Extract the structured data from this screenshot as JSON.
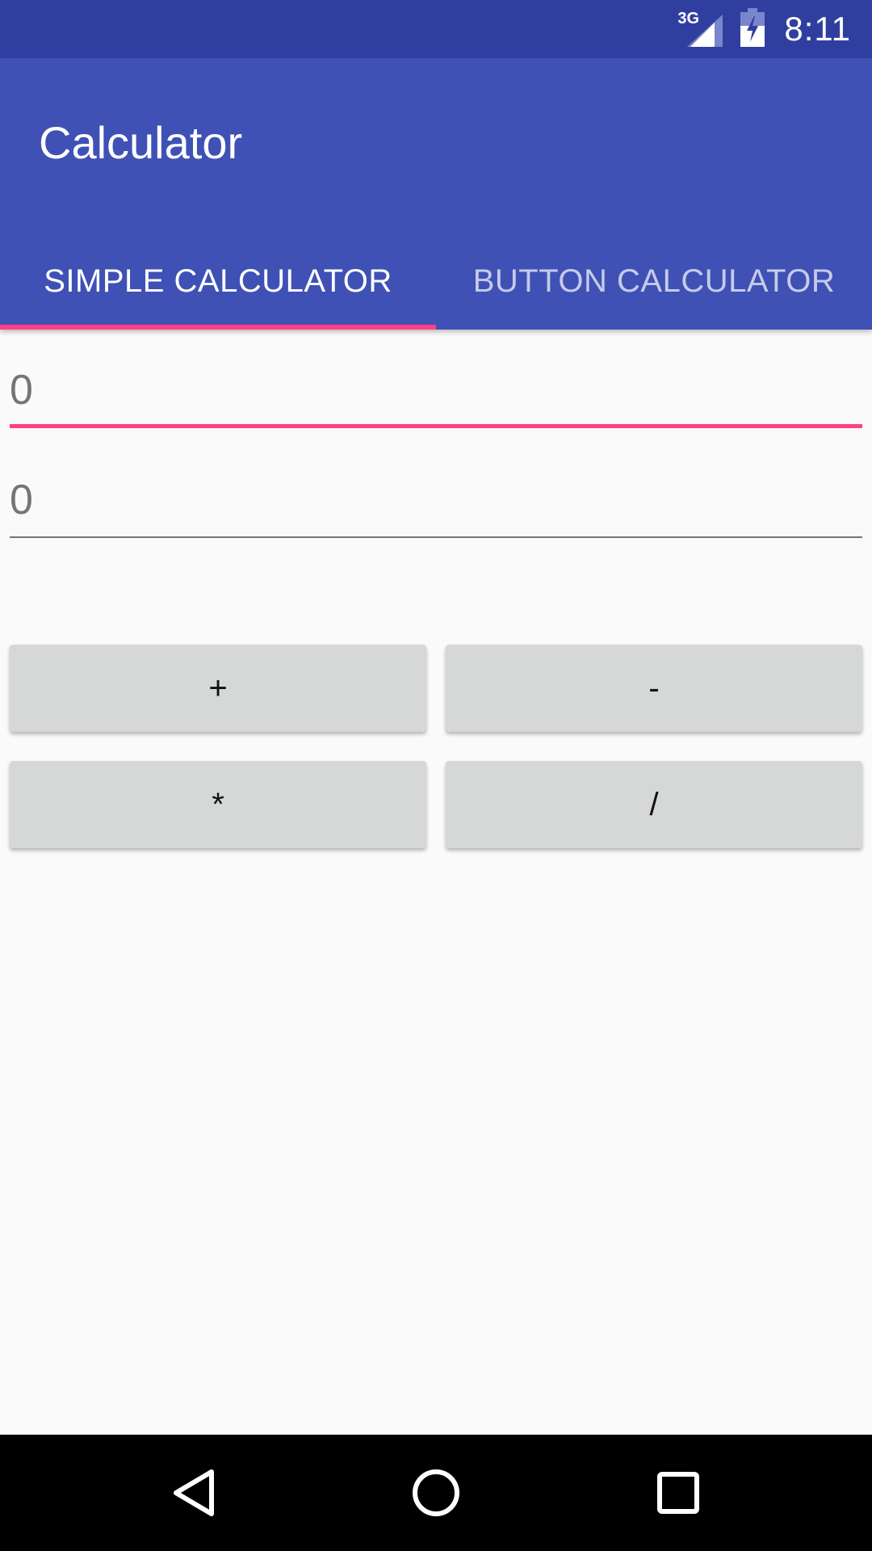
{
  "status_bar": {
    "network": "3G",
    "time": "8:11",
    "icons": [
      "signal-icon",
      "battery-charging-icon"
    ]
  },
  "app_bar": {
    "title": "Calculator",
    "colors": {
      "primary": "#3f51b5",
      "primary_dark": "#303f9f",
      "accent": "#ff4081"
    }
  },
  "tabs": [
    {
      "label": "SIMPLE CALCULATOR",
      "selected": true
    },
    {
      "label": "BUTTON CALCULATOR",
      "selected": false
    }
  ],
  "fields": {
    "first": {
      "placeholder": "0",
      "value": ""
    },
    "second": {
      "placeholder": "0",
      "value": ""
    }
  },
  "buttons": {
    "add": "+",
    "subtract": "-",
    "multiply": "*",
    "divide": "/"
  },
  "nav_bar": {
    "icons": [
      "back-icon",
      "home-icon",
      "recents-icon"
    ]
  }
}
